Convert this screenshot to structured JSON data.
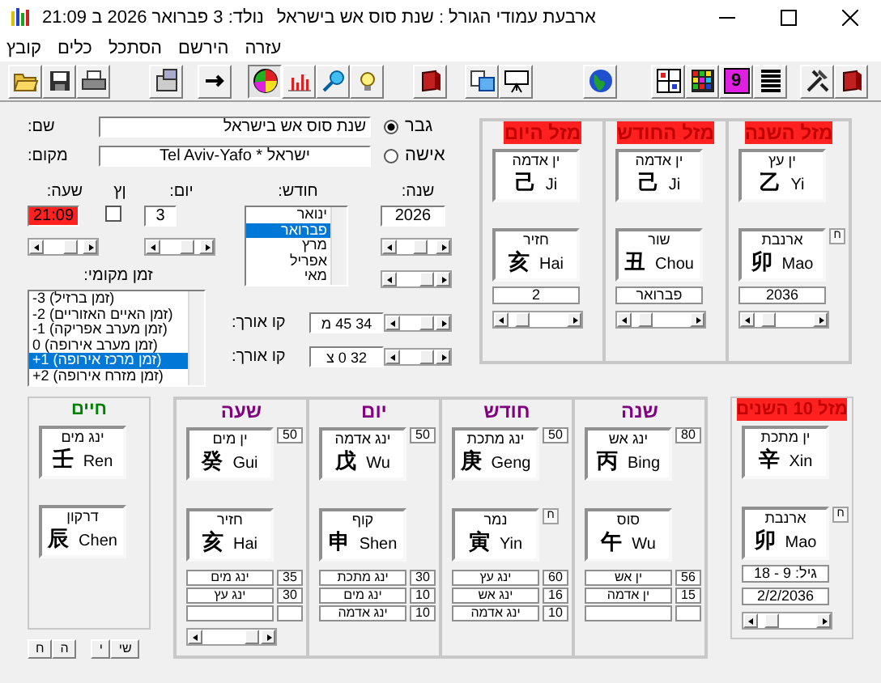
{
  "window": {
    "title": "ארבעת עמודי הגורל : שנת סוס אש בישראל",
    "birth": "נולד: 3 פברואר 2026 ב 21:09"
  },
  "menu": [
    {
      "label": "עזרה"
    },
    {
      "label": "הירשם"
    },
    {
      "label": "הסתכל"
    },
    {
      "label": "כלים"
    },
    {
      "label": "קובץ"
    }
  ],
  "toolbar": [
    [
      {
        "selected": false
      },
      {
        "selected": false
      },
      {
        "selected": false
      }
    ],
    [
      {
        "selected": false
      }
    ],
    [
      {
        "selected": false
      }
    ],
    [
      {
        "selected": true
      },
      {
        "selected": false
      },
      {
        "selected": false
      },
      {
        "selected": false
      }
    ],
    [
      {
        "selected": false
      }
    ],
    [
      {
        "selected": false
      },
      {
        "selected": false
      }
    ],
    [
      {
        "selected": false
      }
    ],
    [
      {
        "selected": false
      },
      {
        "selected": false
      },
      {
        "selected": false,
        "label": "9"
      },
      {
        "selected": false
      }
    ],
    [
      {
        "selected": false
      },
      {
        "selected": false
      }
    ]
  ],
  "form": {
    "name": {
      "label": "שם:",
      "value": "שנת סוס אש בישראל"
    },
    "place": {
      "label": "מקום:",
      "value": "Tel Aviv-Yafo * ישראל"
    },
    "gender": [
      {
        "label": "גבר",
        "selected": true
      },
      {
        "label": "אישה",
        "selected": false
      }
    ],
    "hour": {
      "label": "שעה:",
      "value": "21:09"
    },
    "dst": {
      "label": "ןץ",
      "checked": false
    },
    "day": {
      "label": "יום:",
      "value": "3"
    },
    "month": {
      "label": "חודש:",
      "options": [
        {
          "label": "ינואר",
          "selected": false
        },
        {
          "label": "פברואר",
          "selected": true
        },
        {
          "label": "מרץ",
          "selected": false
        },
        {
          "label": "אפריל",
          "selected": false
        },
        {
          "label": "מאי",
          "selected": false
        }
      ]
    },
    "year": {
      "label": "שנה:",
      "value": "2026"
    },
    "timezone": {
      "label": "זמן מקומי:",
      "options": [
        {
          "label": "-3 (זמן ברזיל)",
          "selected": false
        },
        {
          "label": "-2 (זמן האיים האזוריים)",
          "selected": false
        },
        {
          "label": "-1 (זמן מערב אפריקה)",
          "selected": false
        },
        {
          "label": "0 (זמן מערב אירופה)",
          "selected": false
        },
        {
          "label": "+1 (זמן מרכז אירופה)",
          "selected": true
        },
        {
          "label": "+2 (זמן מזרח אירופה)",
          "selected": false
        }
      ]
    },
    "coords": [
      {
        "label": "קו אורך:",
        "value": "34 45 מ"
      },
      {
        "label": "קו אורך:",
        "value": "32 0 צ"
      }
    ]
  },
  "lucky": [
    {
      "title": "מזל השנה",
      "stem": {
        "element": "ין עץ",
        "glyph": "乙",
        "pinyin": "Yi"
      },
      "branch": {
        "animal": "ארנבת",
        "glyph": "卯",
        "pinyin": "Mao"
      },
      "marker": "ח",
      "value": "2036"
    },
    {
      "title": "מזל החודש",
      "stem": {
        "element": "ין אדמה",
        "glyph": "己",
        "pinyin": "Ji"
      },
      "branch": {
        "animal": "שור",
        "glyph": "丑",
        "pinyin": "Chou"
      },
      "value": "פברואר"
    },
    {
      "title": "מזל היום",
      "stem": {
        "element": "ין אדמה",
        "glyph": "己",
        "pinyin": "Ji"
      },
      "branch": {
        "animal": "חזיר",
        "glyph": "亥",
        "pinyin": "Hai"
      },
      "value": "2"
    }
  ],
  "life": {
    "title": "חיים",
    "stem": {
      "element": "ינג מים",
      "glyph": "壬",
      "pinyin": "Ren"
    },
    "branch": {
      "animal": "דרקון",
      "glyph": "辰",
      "pinyin": "Chen"
    },
    "buttons": [
      {
        "label": "שי"
      },
      {
        "label": "י"
      },
      {
        "label": "ה"
      },
      {
        "label": "ח"
      }
    ]
  },
  "pillars": [
    {
      "title": "שנה",
      "stem": {
        "element": "ינג אש",
        "glyph": "丙",
        "pinyin": "Bing"
      },
      "score": "80",
      "branch": {
        "animal": "סוס",
        "glyph": "午",
        "pinyin": "Wu"
      },
      "scrollbar": false,
      "rows": [
        {
          "kind": "energy",
          "label": "ין אש",
          "value": "56"
        },
        {
          "kind": "energy",
          "label": "ין אדמה",
          "value": "15"
        },
        {
          "kind": "blank"
        }
      ]
    },
    {
      "title": "חודש",
      "stem": {
        "element": "ינג מתכת",
        "glyph": "庚",
        "pinyin": "Geng"
      },
      "score": "50",
      "branch": {
        "animal": "נמר",
        "glyph": "寅",
        "pinyin": "Yin"
      },
      "marker": "ח",
      "scrollbar": false,
      "rows": [
        {
          "kind": "energy",
          "label": "ינג עץ",
          "value": "60"
        },
        {
          "kind": "energy",
          "label": "ינג אש",
          "value": "16"
        },
        {
          "kind": "energy",
          "label": "ינג אדמה",
          "value": "10"
        }
      ]
    },
    {
      "title": "יום",
      "stem": {
        "element": "ינג אדמה",
        "glyph": "戊",
        "pinyin": "Wu"
      },
      "score": "50",
      "branch": {
        "animal": "קוף",
        "glyph": "申",
        "pinyin": "Shen"
      },
      "scrollbar": false,
      "rows": [
        {
          "kind": "energy",
          "label": "ינג מתכת",
          "value": "30"
        },
        {
          "kind": "energy",
          "label": "ינג מים",
          "value": "10"
        },
        {
          "kind": "energy",
          "label": "ינג אדמה",
          "value": "10"
        }
      ]
    },
    {
      "title": "שעה",
      "stem": {
        "element": "ין מים",
        "glyph": "癸",
        "pinyin": "Gui"
      },
      "score": "50",
      "branch": {
        "animal": "חזיר",
        "glyph": "亥",
        "pinyin": "Hai"
      },
      "scrollbar": true,
      "rows": [
        {
          "kind": "energy",
          "label": "ינג מים",
          "value": "35"
        },
        {
          "kind": "energy",
          "label": "ינג עץ",
          "value": "30"
        },
        {
          "kind": "blank"
        }
      ]
    }
  ],
  "decade": {
    "title": "מזל 10 השנים",
    "stem": {
      "element": "ין מתכת",
      "glyph": "辛",
      "pinyin": "Xin"
    },
    "branch": {
      "animal": "ארנבת",
      "glyph": "卯",
      "pinyin": "Mao"
    },
    "marker": "ח",
    "age": "גיל: 9 - 18",
    "date": "2/2/2036"
  }
}
